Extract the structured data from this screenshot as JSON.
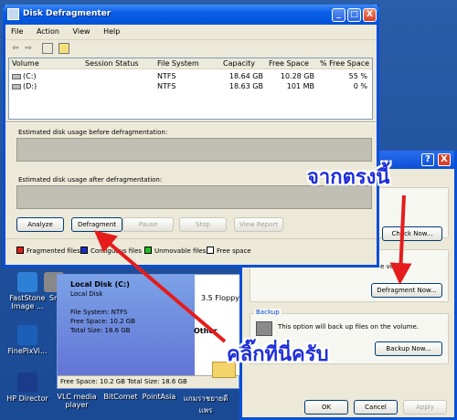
{
  "desktop": {
    "icons": [
      {
        "label": "FastStone Image ...",
        "color": "#2e7fd6"
      },
      {
        "label": "FinePixVi...",
        "color": "#1c5fb8"
      },
      {
        "label": "HP Director",
        "color": "#1a3c8a"
      },
      {
        "label": "VLC media player",
        "color": "#f28a1e"
      },
      {
        "label": "BitComet",
        "color": "#3aa0e0"
      },
      {
        "label": "PointAsia",
        "color": "#2a9a4a"
      },
      {
        "label": "แกมราชยายดี แพร",
        "color": "#d04a3a"
      },
      {
        "label": "Sn",
        "color": "#888888"
      }
    ]
  },
  "explorer": {
    "drive_title": "Local Disk (C:)",
    "drive_type": "Local Disk",
    "filesystem": "File System: NTFS",
    "free_space": "Free Space: 10.2 GB",
    "total_size": "Total Size: 18.6 GB",
    "status": "Free Space: 10.2 GB Total Size: 18.6 GB",
    "floppy": "3.5 Floppy",
    "other_header": "Other"
  },
  "props": {
    "title_help": "?",
    "title_close": "X",
    "check_now_label": "Check Now...",
    "defrag_section_partial": "e vol",
    "defragment_now_label": "Defragment Now...",
    "backup_group_label": "Backup",
    "backup_text": "This option will back up files on the volume.",
    "backup_now_label": "Backup Now...",
    "ok_label": "OK",
    "cancel_label": "Cancel",
    "apply_label": "Apply"
  },
  "window": {
    "title": "Disk Defragmenter",
    "min": "_",
    "max": "□",
    "close": "X",
    "menu": [
      "File",
      "Action",
      "View",
      "Help"
    ],
    "columns": [
      "Volume",
      "Session Status",
      "File System",
      "Capacity",
      "Free Space",
      "% Free Space"
    ],
    "rows": [
      {
        "volume": "(C:)",
        "status": "",
        "fs": "NTFS",
        "capacity": "18.64 GB",
        "free": "10.28 GB",
        "pct": "55 %"
      },
      {
        "volume": "(D:)",
        "status": "",
        "fs": "NTFS",
        "capacity": "18.63 GB",
        "free": "101 MB",
        "pct": "0 %"
      }
    ],
    "est_before": "Estimated disk usage before defragmentation:",
    "est_after": "Estimated disk usage after defragmentation:",
    "buttons": {
      "analyze": "Analyze",
      "defragment": "Defragment",
      "pause": "Pause",
      "stop": "Stop",
      "view_report": "View Report"
    },
    "legend": [
      {
        "label": "Fragmented files",
        "color": "#e02020"
      },
      {
        "label": "Contiguous files",
        "color": "#1a2fc8"
      },
      {
        "label": "Unmovable files",
        "color": "#22c022"
      },
      {
        "label": "Free space",
        "color": "#ffffff"
      }
    ]
  },
  "annotations": {
    "from_here": "จากตรงนี้",
    "click_here": "คลิ๊กที่นี่ครับ",
    "arrow_color": "#e51c1c"
  }
}
